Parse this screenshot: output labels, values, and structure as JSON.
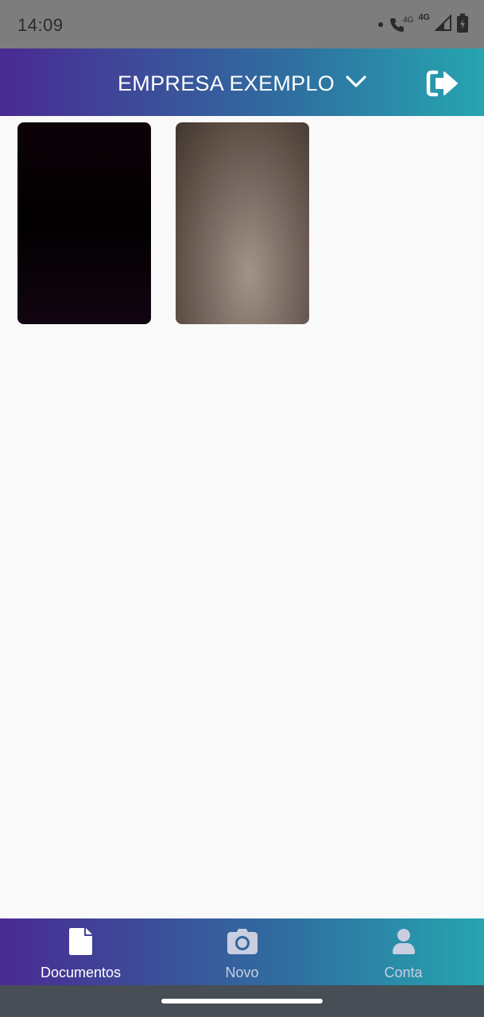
{
  "status_bar": {
    "time": "14:09",
    "network_label_1": "4G",
    "network_label_2": "4G"
  },
  "header": {
    "title": "EMPRESA EXEMPLO",
    "dropdown_icon": "chevron-down-icon",
    "logout_icon": "sign-out-icon"
  },
  "documents": [
    {
      "thumbnail": "dark-photo"
    },
    {
      "thumbnail": "grey-surface-photo"
    }
  ],
  "bottom_nav": {
    "items": [
      {
        "label": "Documentos",
        "icon": "file-icon",
        "active": true
      },
      {
        "label": "Novo",
        "icon": "camera-icon",
        "active": false
      },
      {
        "label": "Conta",
        "icon": "user-icon",
        "active": false
      }
    ]
  },
  "colors": {
    "gradient_start": "#4a2a93",
    "gradient_end": "#26a5b0",
    "status_bar": "#7d7d7d",
    "background": "#f9f9f9"
  }
}
